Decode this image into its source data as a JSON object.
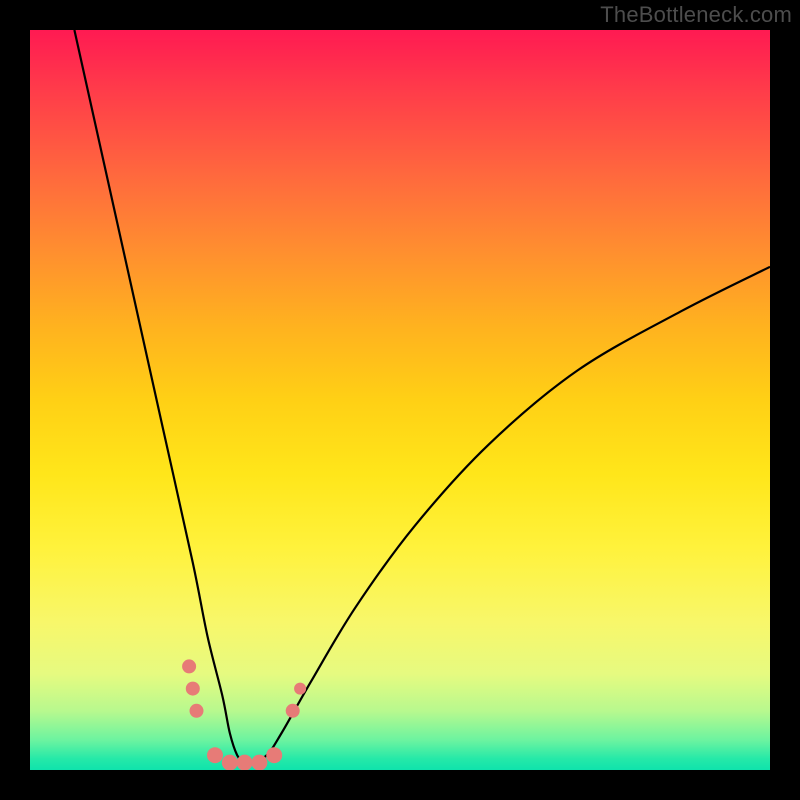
{
  "attribution": "TheBottleneck.com",
  "chart_data": {
    "type": "line",
    "title": "",
    "xlabel": "",
    "ylabel": "",
    "xlim": [
      0,
      100
    ],
    "ylim": [
      0,
      100
    ],
    "background_gradient_meaning": "vertical color scale from red (high bottleneck) at top to green (no bottleneck) at bottom",
    "series": [
      {
        "name": "bottleneck-curve",
        "x": [
          6,
          10,
          14,
          18,
          22,
          24,
          26,
          27,
          28,
          29,
          30,
          32,
          34,
          38,
          44,
          52,
          62,
          74,
          88,
          100
        ],
        "y": [
          100,
          82,
          64,
          46,
          28,
          18,
          10,
          5,
          2,
          1,
          1,
          2,
          5,
          12,
          22,
          33,
          44,
          54,
          62,
          68
        ]
      }
    ],
    "markers": [
      {
        "x": 21.5,
        "y": 14,
        "color": "#e77b77",
        "r": 7
      },
      {
        "x": 22.0,
        "y": 11,
        "color": "#e77b77",
        "r": 7
      },
      {
        "x": 22.5,
        "y": 8,
        "color": "#e77b77",
        "r": 7
      },
      {
        "x": 25.0,
        "y": 2,
        "color": "#e77b77",
        "r": 8
      },
      {
        "x": 27.0,
        "y": 1,
        "color": "#e77b77",
        "r": 8
      },
      {
        "x": 29.0,
        "y": 1,
        "color": "#e77b77",
        "r": 8
      },
      {
        "x": 31.0,
        "y": 1,
        "color": "#e77b77",
        "r": 8
      },
      {
        "x": 33.0,
        "y": 2,
        "color": "#e77b77",
        "r": 8
      },
      {
        "x": 35.5,
        "y": 8,
        "color": "#e77b77",
        "r": 7
      },
      {
        "x": 36.5,
        "y": 11,
        "color": "#e77b77",
        "r": 6
      }
    ]
  }
}
